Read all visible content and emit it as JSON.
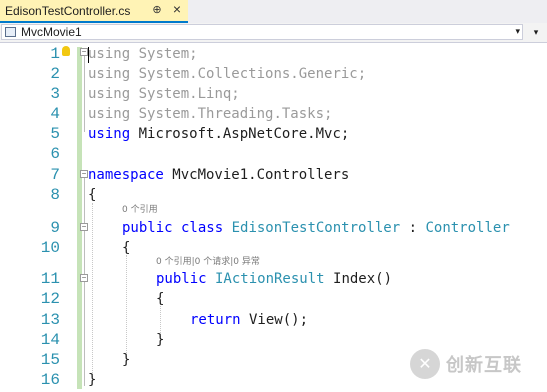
{
  "tab": {
    "title": "EdisonTestController.cs",
    "pin_glyph": "⊕",
    "close_glyph": "×"
  },
  "navbar": {
    "project": "MvcMovie1",
    "dropdown_glyph": "▾"
  },
  "code": {
    "line_numbers": [
      "1",
      "2",
      "3",
      "4",
      "5",
      "6",
      "7",
      "8",
      "9",
      "10",
      "11",
      "12",
      "13",
      "14",
      "15",
      "16"
    ],
    "l1_kw": "using",
    "l1_rest": " System;",
    "l2_kw": "using",
    "l2_rest": " System.Collections.Generic;",
    "l3_kw": "using",
    "l3_rest": " System.Linq;",
    "l4_kw": "using",
    "l4_rest": " System.Threading.Tasks;",
    "l5_kw": "using",
    "l5_rest": " Microsoft.AspNetCore.Mvc;",
    "l7_kw": "namespace",
    "l7_rest": " MvcMovie1.Controllers",
    "open_brace": "{",
    "close_brace": "}",
    "lens_class": "0 个引用",
    "l9_kw1": "public",
    "l9_kw2": " class ",
    "l9_type": "EdisonTestController",
    "l9_sep": " : ",
    "l9_base": "Controller",
    "lens_method": "0 个引用|0 个请求|0 异常",
    "l11_kw": "public",
    "l11_type": " IActionResult",
    "l11_rest": " Index()",
    "l13_kw": "return",
    "l13_rest": " View();"
  },
  "watermark": {
    "logo_glyph": "✕",
    "text": "创新互联"
  }
}
